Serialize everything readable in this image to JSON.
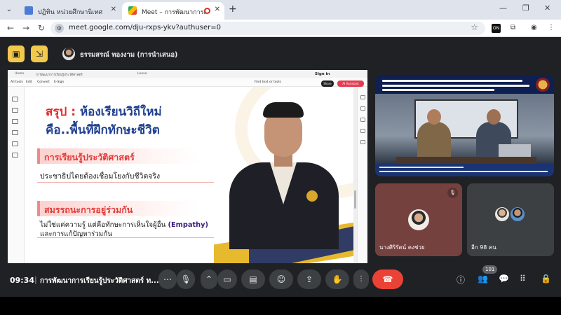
{
  "browser": {
    "tabs": [
      {
        "title": "ปฏิทิน หน่วยศึกษานิเทศก์ สพฐ. - ปี",
        "active": false
      },
      {
        "title": "Meet – การพัฒนาการเรียนรู้ประ",
        "active": true
      }
    ],
    "new_tab": "+",
    "url": "meet.google.com/dju-rxps-ykv?authuser=0",
    "extension_badge": "ON"
  },
  "meet": {
    "presenter_label": "ธรรมสรณ์ ทองงาม (การนำเสนอ)",
    "time": "09:34",
    "separator": "|",
    "meeting_title": "การพัฒนาการเรียนรู้ประวัติศาสตร์ ท...",
    "participant_count": "101"
  },
  "pdf_viewer": {
    "top_tabs": [
      "Home",
      "การพัฒนาการเรียนรู้ประวัติศาสตร์",
      "Leave"
    ],
    "sign_in": "Sign in",
    "menu": [
      "All tools",
      "Edit",
      "Convert",
      "E-Sign"
    ],
    "search": "Find text or tools",
    "share": "Share",
    "ai_assistant": "AI Assistant"
  },
  "slide": {
    "title_prefix": "สรุป",
    "title_colon": " : ",
    "title_line1": "ห้องเรียนวิถีใหม่",
    "title_line2": "คือ..พื้นที่ฝึกทักษะชีวิต",
    "section1_heading": "การเรียนรู้ประวัติศาสตร์",
    "section1_text": "ประชาธิปไตยต้องเชื่อมโยงกับชีวิตจริง",
    "section2_heading": "สมรรถนะการอยู่ร่วมกัน",
    "section2_text_a": "ไม่ใช่แค่ความรู้ แต่คือทักษะการเห็นใจผู้อื่น ",
    "section2_text_em": "(Empathy)",
    "section2_text_b": "และการแก้ปัญหาร่วมกัน"
  },
  "tiles": {
    "participant1_name": "นางศิริรัตน์ คงช่วย",
    "others_label": "อีก 98 คน"
  },
  "colors": {
    "accent_red": "#e7252b",
    "title_blue": "#1f3f8f",
    "end_call": "#ea4335",
    "tile_bg": "#75413f"
  },
  "icons": {
    "tab_menu": "chevron-down-icon",
    "back": "arrow-left-icon",
    "forward": "arrow-right-icon",
    "reload": "reload-icon",
    "star": "star-icon",
    "mic": "microphone-icon",
    "camera": "camera-icon",
    "captions": "captions-icon",
    "emoji": "emoji-icon",
    "present": "present-screen-icon",
    "hand": "raise-hand-icon",
    "more": "more-vert-icon",
    "end_call": "phone-end-icon",
    "info": "info-icon",
    "people": "people-icon",
    "chat": "chat-icon",
    "activities": "apps-grid-icon",
    "host_controls": "lock-person-icon"
  }
}
